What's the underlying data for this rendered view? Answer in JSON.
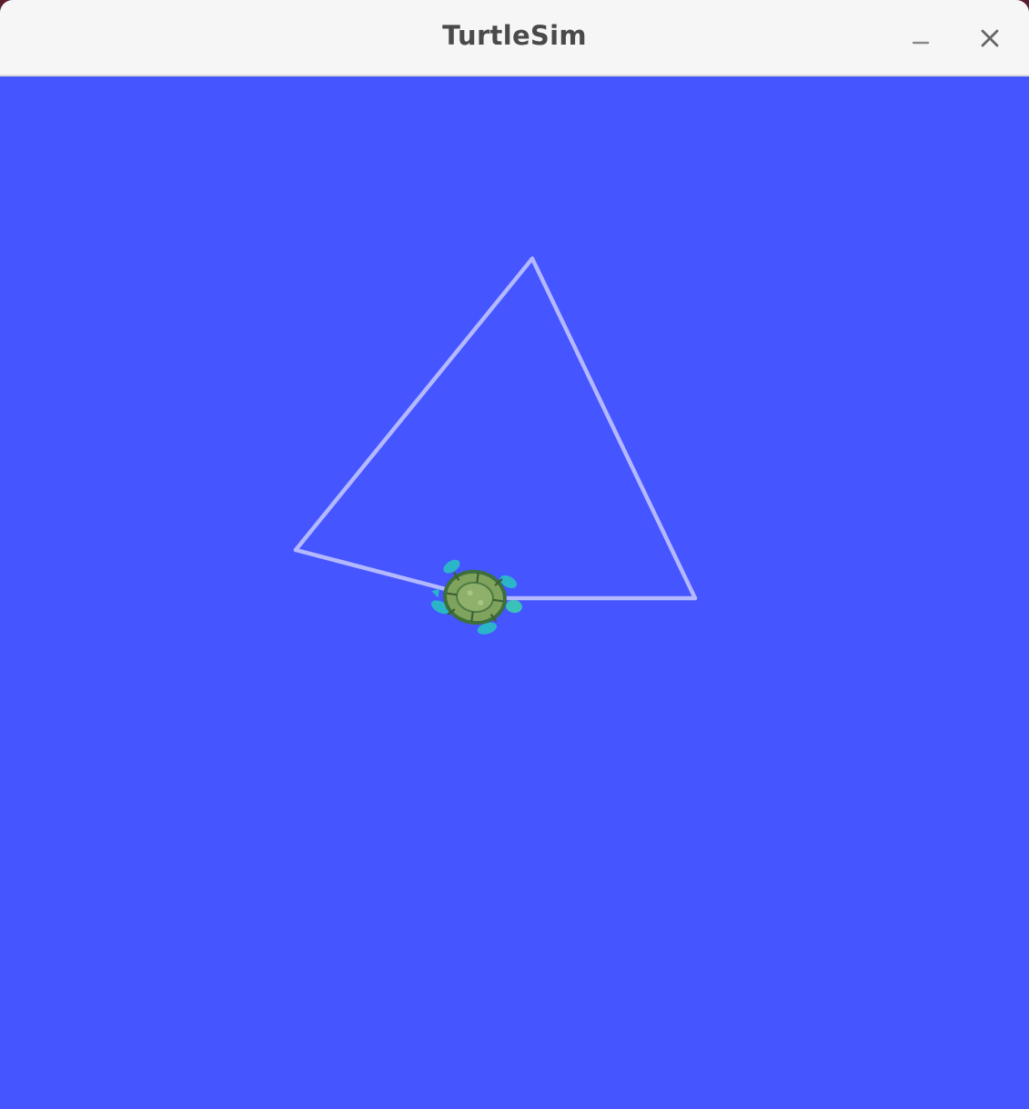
{
  "window": {
    "title": "TurtleSim"
  },
  "titlebar_buttons": {
    "minimize_icon": "minimize-icon",
    "close_icon": "close-icon"
  },
  "colors": {
    "background": "#4555ff",
    "pen": "#b3b8ff",
    "titlebar": "#f6f6f6",
    "title_text": "#4a4a4a"
  },
  "scene": {
    "turtle_icon": "turtle-icon"
  }
}
